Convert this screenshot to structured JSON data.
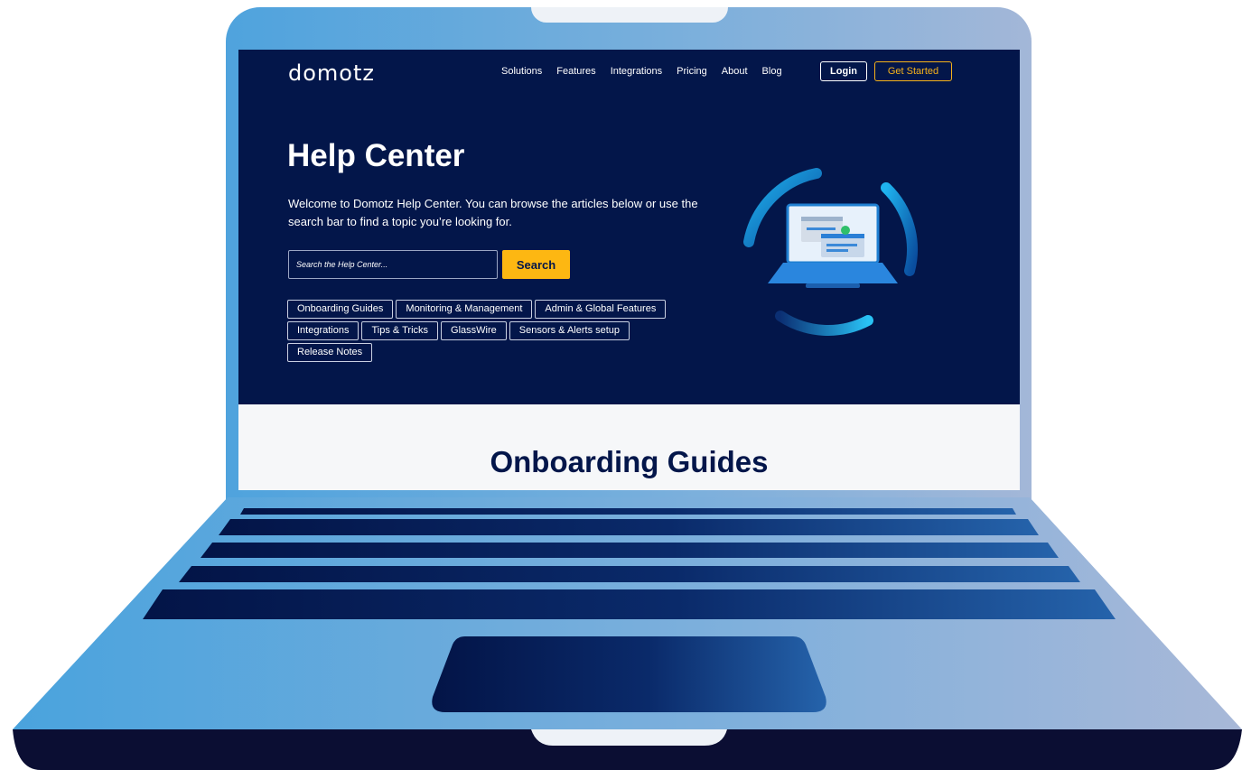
{
  "brand": {
    "logo_text": "domotz"
  },
  "nav": {
    "items": [
      {
        "label": "Solutions"
      },
      {
        "label": "Features"
      },
      {
        "label": "Integrations"
      },
      {
        "label": "Pricing"
      },
      {
        "label": "About"
      },
      {
        "label": "Blog"
      }
    ],
    "login_label": "Login",
    "get_started_label": "Get Started"
  },
  "hero": {
    "title": "Help Center",
    "welcome_text": "Welcome to Domotz Help Center. You can browse the articles below or use the search bar to find a topic you’re looking for.",
    "search": {
      "placeholder": "Search the Help Center...",
      "button_label": "Search"
    },
    "categories": [
      {
        "label": "Onboarding Guides"
      },
      {
        "label": "Monitoring & Management"
      },
      {
        "label": "Admin & Global Features"
      },
      {
        "label": "Integrations"
      },
      {
        "label": "Tips & Tricks"
      },
      {
        "label": "GlassWire"
      },
      {
        "label": "Sensors & Alerts setup"
      },
      {
        "label": "Release Notes"
      }
    ]
  },
  "section": {
    "title": "Onboarding Guides"
  },
  "colors": {
    "hero_bg": "#03164a",
    "accent_yellow": "#fdb712",
    "frame_blue": "#4fa3dd",
    "frame_dark": "#0b0e33"
  }
}
